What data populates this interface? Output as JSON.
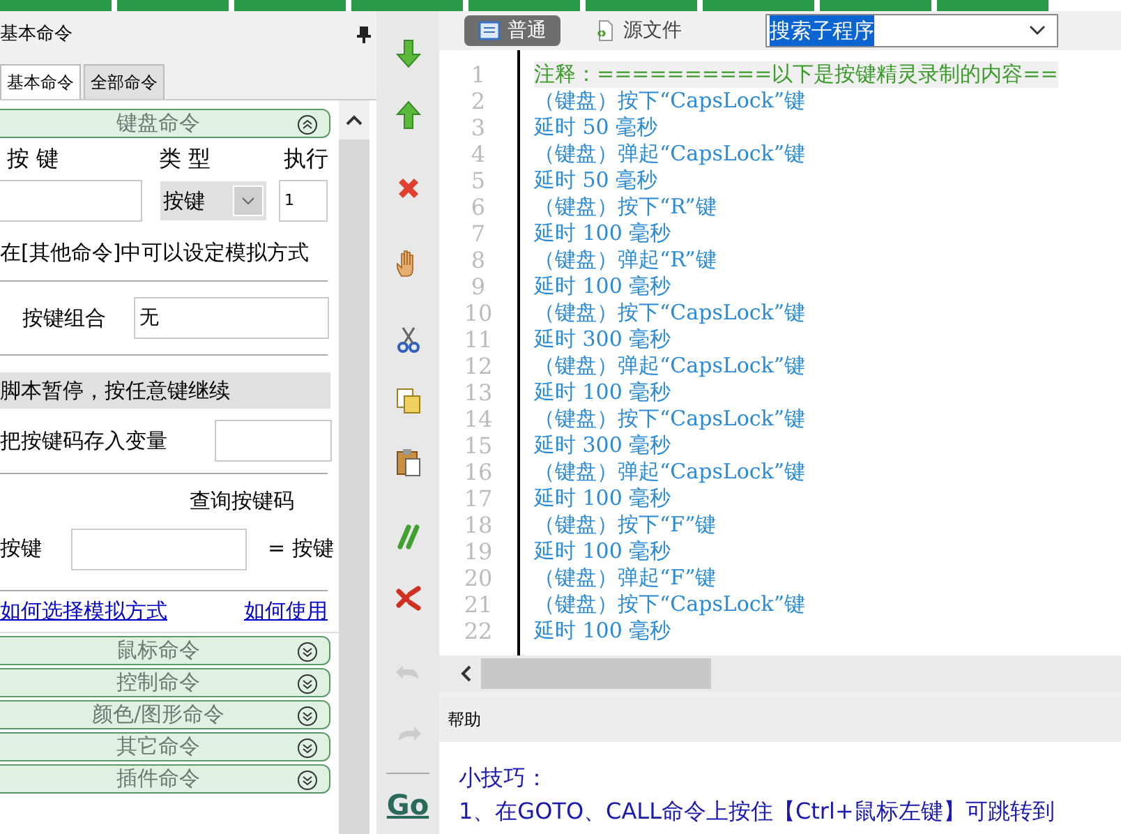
{
  "panel": {
    "title": "基本命令",
    "tabs": [
      {
        "label": "基本命令",
        "selected": true
      },
      {
        "label": "全部命令",
        "selected": false
      }
    ],
    "sections": [
      {
        "title": "键盘命令",
        "expanded": true
      },
      {
        "title": "鼠标命令",
        "expanded": false
      },
      {
        "title": "控制命令",
        "expanded": false
      },
      {
        "title": "颜色/图形命令",
        "expanded": false
      },
      {
        "title": "其它命令",
        "expanded": false
      },
      {
        "title": "插件命令",
        "expanded": false
      }
    ],
    "keyboard": {
      "columns": [
        "按 键",
        "类 型",
        "执行"
      ],
      "type_value": "按键",
      "exec_value": "1",
      "hint": "在[其他命令]中可以设定模拟方式",
      "combo_label": "按键组合",
      "combo_value": "无",
      "pause_label": "脚本暂停，按任意键继续",
      "store_label": "把按键码存入变量",
      "query_label": "查询按键码",
      "query_key_label": "按键",
      "query_result": "= 按键",
      "links": [
        "如何选择模拟方式",
        "如何使用"
      ]
    }
  },
  "side_toolbar": [
    {
      "disabled": false
    },
    {
      "disabled": false
    },
    {
      "disabled": false
    },
    {
      "disabled": false
    },
    {
      "disabled": false
    },
    {
      "disabled": false
    },
    {
      "disabled": false
    },
    {
      "disabled": false
    },
    {
      "disabled": false
    },
    {
      "disabled": true
    },
    {
      "disabled": true
    },
    {
      "label": "Go",
      "disabled": false
    }
  ],
  "editor": {
    "view_tabs": [
      {
        "label": "普通",
        "selected": true
      },
      {
        "label": "源文件",
        "selected": false
      }
    ],
    "search": {
      "value": "搜索子程序"
    },
    "lines": [
      {
        "number": "1",
        "kind": "comment",
        "text": "注释：==========以下是按键精灵录制的内容=="
      },
      {
        "number": "2",
        "kind": "code",
        "text": "（键盘）按下“CapsLock”键"
      },
      {
        "number": "3",
        "kind": "code",
        "text": "延时 50 毫秒"
      },
      {
        "number": "4",
        "kind": "code",
        "text": "（键盘）弹起“CapsLock”键"
      },
      {
        "number": "5",
        "kind": "code",
        "text": "延时 50 毫秒"
      },
      {
        "number": "6",
        "kind": "code",
        "text": "（键盘）按下“R”键"
      },
      {
        "number": "7",
        "kind": "code",
        "text": "延时 100 毫秒"
      },
      {
        "number": "8",
        "kind": "code",
        "text": "（键盘）弹起“R”键"
      },
      {
        "number": "9",
        "kind": "code",
        "text": "延时 100 毫秒"
      },
      {
        "number": "10",
        "kind": "code",
        "text": "（键盘）按下“CapsLock”键"
      },
      {
        "number": "11",
        "kind": "code",
        "text": "延时 300 毫秒"
      },
      {
        "number": "12",
        "kind": "code",
        "text": "（键盘）弹起“CapsLock”键"
      },
      {
        "number": "13",
        "kind": "code",
        "text": "延时 100 毫秒"
      },
      {
        "number": "14",
        "kind": "code",
        "text": "（键盘）按下“CapsLock”键"
      },
      {
        "number": "15",
        "kind": "code",
        "text": "延时 300 毫秒"
      },
      {
        "number": "16",
        "kind": "code",
        "text": "（键盘）弹起“CapsLock”键"
      },
      {
        "number": "17",
        "kind": "code",
        "text": "延时 100 毫秒"
      },
      {
        "number": "18",
        "kind": "code",
        "text": "（键盘）按下“F”键"
      },
      {
        "number": "19",
        "kind": "code",
        "text": "延时 100 毫秒"
      },
      {
        "number": "20",
        "kind": "code",
        "text": "（键盘）弹起“F”键"
      },
      {
        "number": "21",
        "kind": "code",
        "text": "（键盘）按下“CapsLock”键"
      },
      {
        "number": "22",
        "kind": "code",
        "text": "延时 100 毫秒"
      }
    ]
  },
  "help": {
    "title": "帮助",
    "heading": "小技巧：",
    "tips": [
      "1、在GOTO、CALL命令上按住【Ctrl+鼠标左键】可跳转到"
    ]
  }
}
